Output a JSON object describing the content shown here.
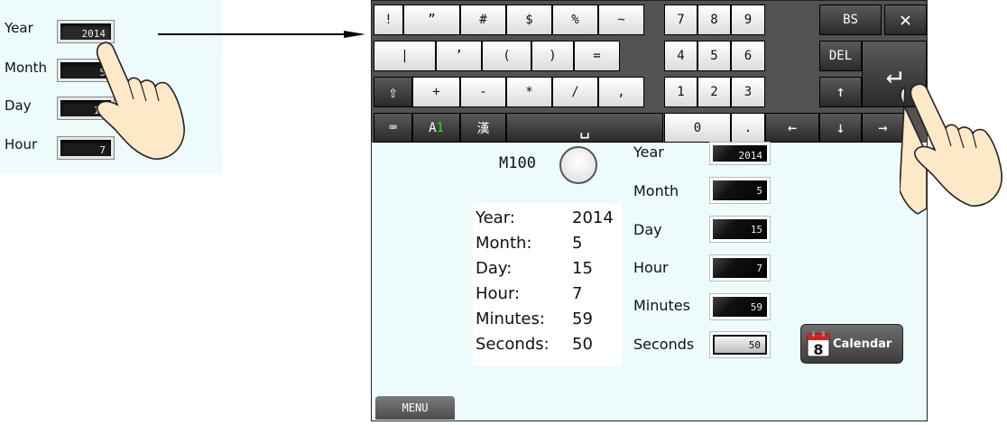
{
  "inset": {
    "fields": [
      {
        "label": "Year",
        "value": "2014"
      },
      {
        "label": "Month",
        "value": "5"
      },
      {
        "label": "Day",
        "value": "15"
      },
      {
        "label": "Hour",
        "value": "7"
      }
    ]
  },
  "keyboard": {
    "row1_symbols": [
      "!",
      "”",
      "#",
      "$",
      "%",
      "~"
    ],
    "row2_symbols": [
      "|",
      "’",
      "(",
      ")",
      "="
    ],
    "row3_symbols": [
      "+",
      "-",
      "*",
      "/",
      ","
    ],
    "digits_row1": [
      "7",
      "8",
      "9"
    ],
    "digits_row2": [
      "4",
      "5",
      "6"
    ],
    "digits_row3": [
      "1",
      "2",
      "3"
    ],
    "zero": "0",
    "dot": ".",
    "bs": "BS",
    "del": "DEL",
    "close": "✕",
    "enter": "↵",
    "shift": "⇧",
    "space": "␣",
    "kana_mode": "漢",
    "alpha_a": "A",
    "alpha_num": "1",
    "arrow_up": "↑",
    "arrow_down": "↓",
    "arrow_left": "←",
    "arrow_right": "→",
    "keyboard_icon": "⌨"
  },
  "screen": {
    "lamp_label": "M100",
    "info": [
      {
        "label": "Year:",
        "value": "2014"
      },
      {
        "label": "Month:",
        "value": "5"
      },
      {
        "label": "Day:",
        "value": "15"
      },
      {
        "label": "Hour:",
        "value": "7"
      },
      {
        "label": "Minutes:",
        "value": "59"
      },
      {
        "label": "Seconds:",
        "value": "50"
      }
    ],
    "fields": [
      {
        "label": "Year",
        "value": "2014"
      },
      {
        "label": "Month",
        "value": "5"
      },
      {
        "label": "Day",
        "value": "15"
      },
      {
        "label": "Hour",
        "value": "7"
      },
      {
        "label": "Minutes",
        "value": "59"
      },
      {
        "label": "Seconds",
        "value": "50"
      }
    ],
    "calendar_label": "Calendar",
    "calendar_day": "8",
    "menu_label": "MENU"
  },
  "colors": {
    "panel_bg": "#eefbfd",
    "keyboard_bg": "#525252",
    "numeral_on": "#21e321"
  }
}
